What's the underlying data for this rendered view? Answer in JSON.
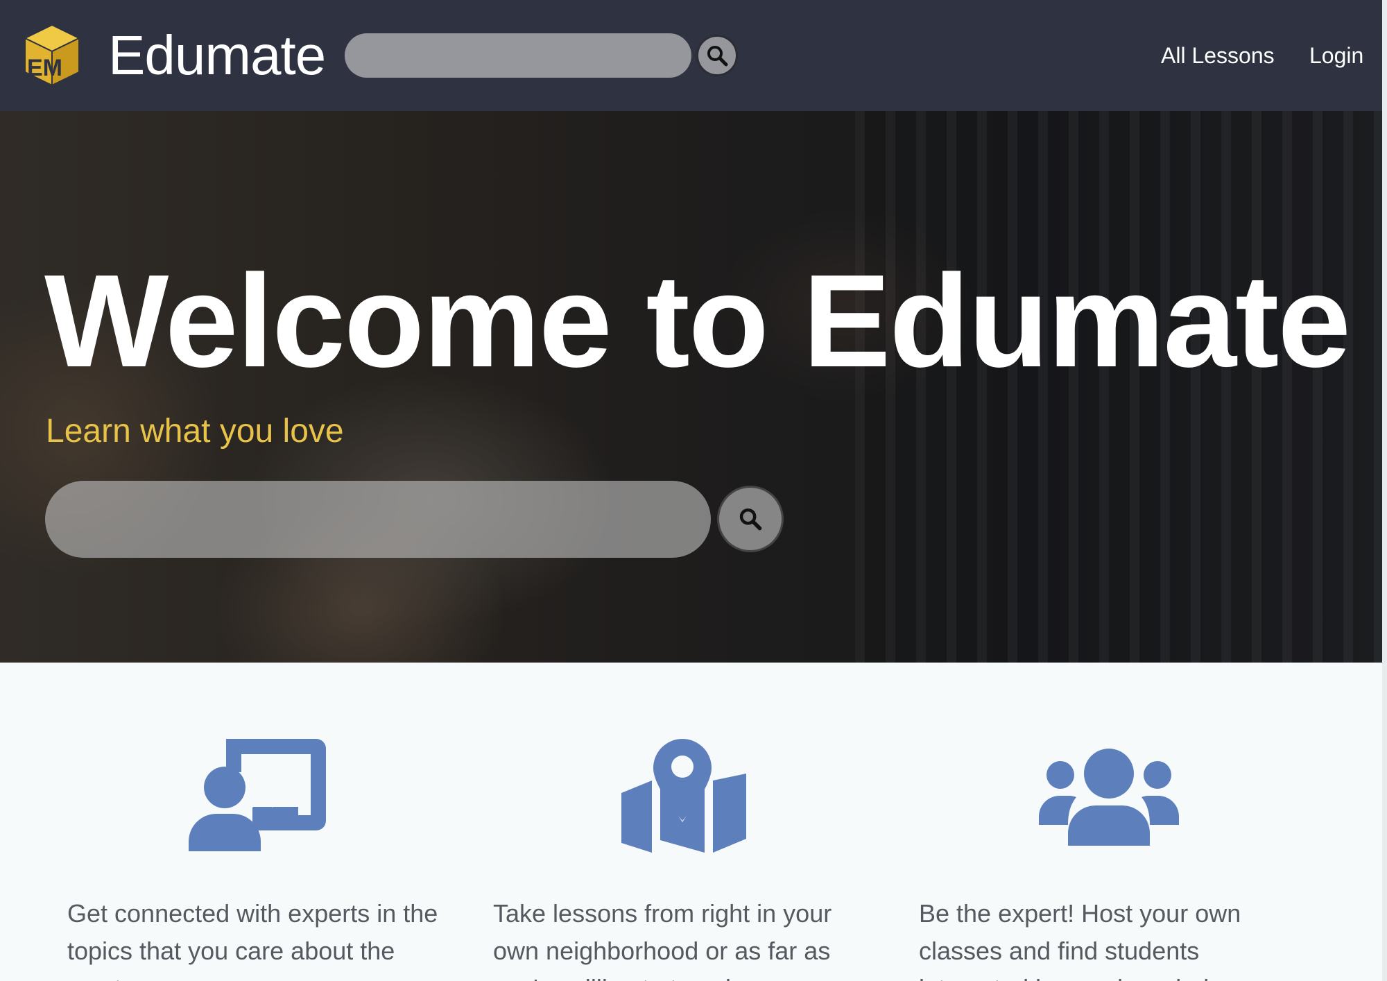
{
  "header": {
    "brand": "Edumate",
    "logo_letters": "EM",
    "search_placeholder": "",
    "nav": {
      "all_lessons": "All Lessons",
      "login": "Login"
    }
  },
  "hero": {
    "title": "Welcome to Edumate",
    "subtitle": "Learn what you love",
    "search_placeholder": ""
  },
  "features": [
    {
      "icon": "chalkboard-teacher-icon",
      "text": "Get connected with experts in the topics that you care about the most."
    },
    {
      "icon": "map-marked-icon",
      "text": "Take lessons from right in your own neighborhood or as far as you're willing to travel."
    },
    {
      "icon": "users-group-icon",
      "text": "Be the expert! Host your own classes and find students interested in your knowledge."
    }
  ],
  "colors": {
    "navbar_bg": "#2f3240",
    "accent_gold": "#e8c34a",
    "feature_icon_blue": "#5d80bc",
    "feature_text": "#555a60",
    "features_bg": "#f7fafb"
  }
}
